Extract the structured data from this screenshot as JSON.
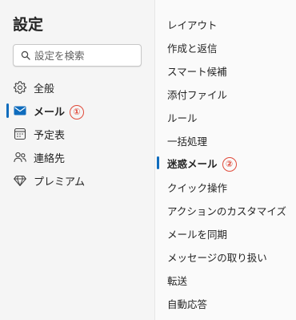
{
  "header": {
    "title": "設定"
  },
  "search": {
    "placeholder": "設定を検索",
    "value": ""
  },
  "nav": {
    "items": [
      {
        "label": "全般"
      },
      {
        "label": "メール",
        "badge": "①"
      },
      {
        "label": "予定表"
      },
      {
        "label": "連絡先"
      },
      {
        "label": "プレミアム"
      }
    ]
  },
  "subnav": {
    "items": [
      {
        "label": "レイアウト"
      },
      {
        "label": "作成と返信"
      },
      {
        "label": "スマート候補"
      },
      {
        "label": "添付ファイル"
      },
      {
        "label": "ルール"
      },
      {
        "label": "一括処理"
      },
      {
        "label": "迷惑メール",
        "badge": "②"
      },
      {
        "label": "クイック操作"
      },
      {
        "label": "アクションのカスタマイズ"
      },
      {
        "label": "メールを同期"
      },
      {
        "label": "メッセージの取り扱い"
      },
      {
        "label": "転送"
      },
      {
        "label": "自動応答"
      }
    ]
  },
  "colors": {
    "accent": "#0f6cbd",
    "annotation": "#e04a3a"
  }
}
